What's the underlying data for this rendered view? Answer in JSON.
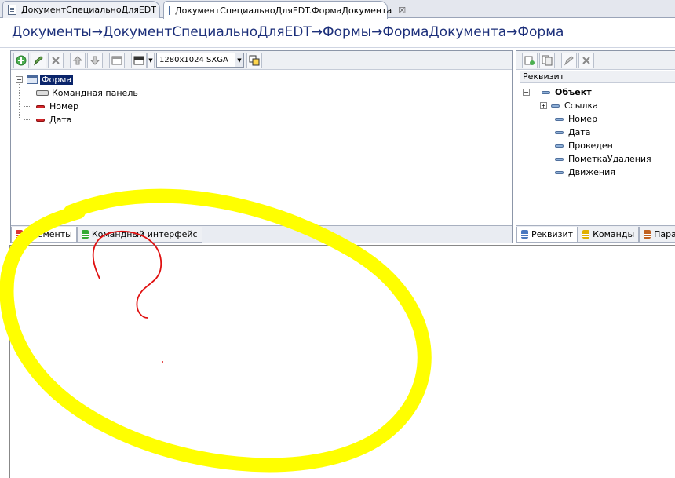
{
  "tabs": [
    {
      "label": "ДокументСпециальноДляEDT",
      "active": false,
      "icon": "document-icon"
    },
    {
      "label": "ДокументСпециальноДляEDT.ФормаДокумента",
      "active": true,
      "icon": "form-icon"
    }
  ],
  "breadcrumb": "Документы→ДокументСпециальноДляEDT→Формы→ФормаДокумента→Форма",
  "left_panel": {
    "resolution": "1280x1024 SXGA",
    "tree": {
      "root": "Форма",
      "children": [
        "Командная панель",
        "Номер",
        "Дата"
      ]
    },
    "bottom_tabs": [
      {
        "label": "Элементы",
        "active": true
      },
      {
        "label": "Командный интерфейс",
        "active": false
      }
    ]
  },
  "right_panel": {
    "column_header": "Реквизит",
    "tree": {
      "root": "Объект",
      "children": [
        "Ссылка",
        "Номер",
        "Дата",
        "Проведен",
        "ПометкаУдаления",
        "Движения"
      ]
    },
    "bottom_tabs": [
      {
        "label": "Реквизит",
        "active": true
      },
      {
        "label": "Команды",
        "active": false
      },
      {
        "label": "Парам",
        "active": false
      }
    ]
  },
  "colors": {
    "annotation_yellow": "#ffff00",
    "annotation_red": "#e01010",
    "breadcrumb": "#1c2f7a",
    "selection": "#0a246a"
  }
}
